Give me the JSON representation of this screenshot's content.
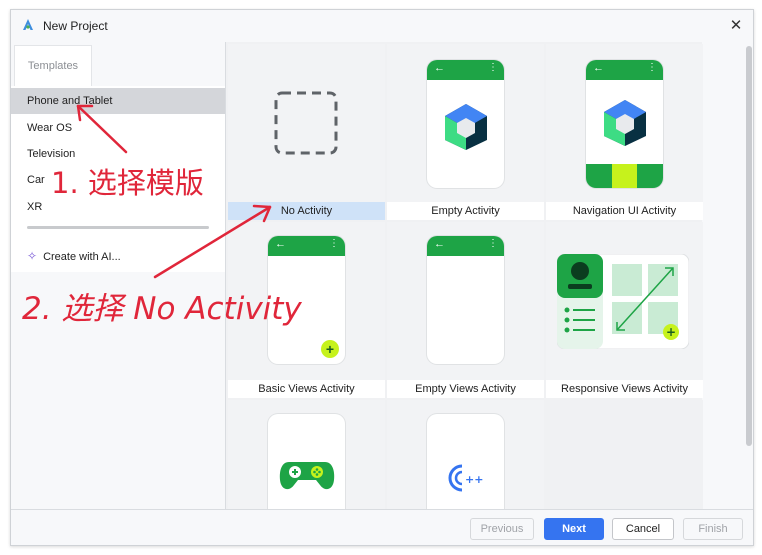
{
  "window": {
    "title": "New Project"
  },
  "sidebar": {
    "tab_label": "Templates",
    "items": [
      {
        "label": "Phone and Tablet"
      },
      {
        "label": "Wear OS"
      },
      {
        "label": "Television"
      },
      {
        "label": "Car"
      },
      {
        "label": "XR"
      }
    ],
    "create_ai_label": "Create with AI..."
  },
  "templates": [
    {
      "label": "No Activity"
    },
    {
      "label": "Empty Activity"
    },
    {
      "label": "Navigation UI Activity"
    },
    {
      "label": "Basic Views Activity"
    },
    {
      "label": "Empty Views Activity"
    },
    {
      "label": "Responsive Views Activity"
    }
  ],
  "footer": {
    "previous_label": "Previous",
    "next_label": "Next",
    "cancel_label": "Cancel",
    "finish_label": "Finish"
  },
  "annotations": {
    "step1": "1. 选择模版",
    "step2": "2. 选择 No Activity"
  },
  "colors": {
    "accent": "#3574f0",
    "android_green": "#1ea446",
    "annotation_red": "#e0263a",
    "selection_blue": "#cfe2f8"
  }
}
